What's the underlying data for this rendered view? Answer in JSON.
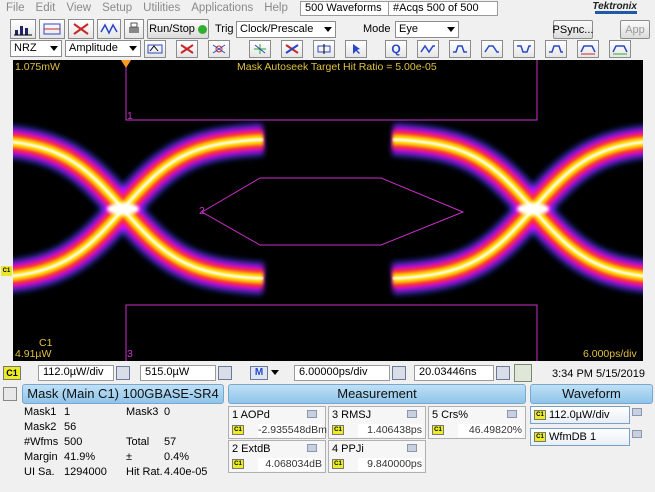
{
  "menu": [
    "File",
    "Edit",
    "View",
    "Setup",
    "Utilities",
    "Applications",
    "Help"
  ],
  "header": {
    "waveforms": "500 Waveforms",
    "acqs": "#Acqs  500 of 500",
    "brand": "Tektronix"
  },
  "toolbar": {
    "run_stop": "Run/Stop",
    "trig_label": "Trig",
    "trig_value": "Clock/Prescale",
    "mode_label": "Mode",
    "mode_value": "Eye",
    "psync": "PSync...",
    "app": "App"
  },
  "toolbar2": {
    "nrz": "NRZ",
    "amplitude": "Amplitude",
    "icons": [
      "autoset-icon",
      "clear-icon",
      "wave-delete-icon",
      "wave-x-icon",
      "mask-icon",
      "wave-toggle-icon",
      "scale-icon",
      "histogram-icon",
      "cursor-icon",
      "q-icon",
      "eye-icon-1",
      "eye-icon-2",
      "eye-icon-3",
      "eye-icon-4",
      "eye-icon-5",
      "eye-icon-6",
      "eye-icon-7"
    ]
  },
  "scope": {
    "top_left": "1.075mW",
    "banner": "Mask Autoseek Target Hit Ratio = 5.00e-05",
    "bottom_left_ch": "C1",
    "bottom_left_val": "4.91µW",
    "bottom_right": "6.000ps/div",
    "mask_labels": [
      "1",
      "2",
      "3"
    ],
    "colors": {
      "eye_hot": "#ffffff",
      "eye_mid": "#ffe000",
      "eye_warm": "#ff2a2a",
      "eye_cool": "#ff00ff",
      "eye_cold": "#2a48ff",
      "mask": "#cc30cc"
    }
  },
  "status": {
    "c1": "C1",
    "scale": "112.0µW/div",
    "offset": "515.0µW",
    "m": "M",
    "timebase": "6.00000ps/div",
    "position": "20.03446ns",
    "time": "3:34 PM 5/15/2019"
  },
  "mask": {
    "title": "Mask (Main  C1) 100GBASE-SR4",
    "rows": [
      {
        "k1": "Mask1",
        "v1": "1",
        "k2": "Mask3",
        "v2": "0"
      },
      {
        "k1": "Mask2",
        "v1": "56",
        "k2": "",
        "v2": ""
      },
      {
        "k1": "#Wfms",
        "v1": "500",
        "k2": "Total",
        "v2": "57"
      },
      {
        "k1": "Margin",
        "v1": "41.9%",
        "k2": "±",
        "v2": "0.4%"
      },
      {
        "k1": "UI Sa.",
        "v1": "1294000",
        "k2": "Hit Rat.",
        "v2": "4.40e-05"
      }
    ]
  },
  "measurement": {
    "title": "Measurement",
    "items": [
      {
        "label": "1 AOPd",
        "value": "-2.935548dBm"
      },
      {
        "label": "3 RMSJ",
        "value": "1.406438ps"
      },
      {
        "label": "5 Crs%",
        "value": "46.49820%"
      },
      {
        "label": "2 ExtdB",
        "value": "4.068034dB"
      },
      {
        "label": "4 PPJi",
        "value": "9.840000ps"
      }
    ]
  },
  "waveform": {
    "title": "Waveform",
    "items": [
      "112.0µW/div",
      "WfmDB 1"
    ]
  }
}
